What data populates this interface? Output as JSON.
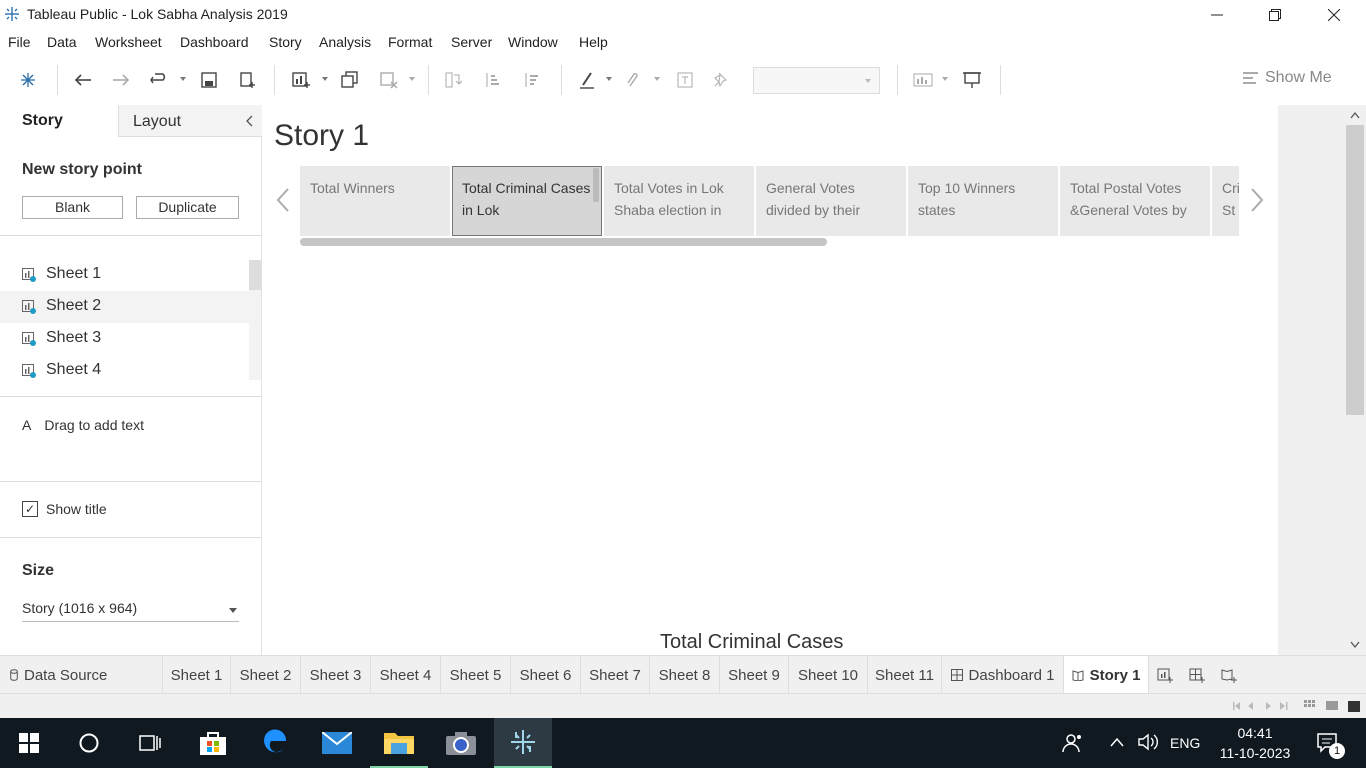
{
  "window": {
    "title": "Tableau Public - Lok Sabha Analysis 2019"
  },
  "menu": [
    "File",
    "Data",
    "Worksheet",
    "Dashboard",
    "Story",
    "Analysis",
    "Format",
    "Server",
    "Window",
    "Help"
  ],
  "toolbar": {
    "show_me": "Show Me"
  },
  "left_pane": {
    "tab_story": "Story",
    "tab_layout": "Layout",
    "new_story_point": "New story point",
    "blank_button": "Blank",
    "duplicate_button": "Duplicate",
    "sheets": [
      "Sheet 1",
      "Sheet 2",
      "Sheet 3",
      "Sheet 4"
    ],
    "drag_text_icon": "A",
    "drag_text": "Drag to add text",
    "show_title_check": "✓",
    "show_title": "Show title",
    "size_heading": "Size",
    "size_value": "Story (1016 x 964)"
  },
  "story": {
    "title": "Story 1",
    "points": [
      "Total Winners",
      "Total Criminal Cases in Lok",
      "Total  Votes in Lok Shaba election in",
      "General Votes divided by their",
      "Top 10 Winners states",
      "Total Postal Votes &General Votes by",
      "Cri St"
    ],
    "active_index": 1,
    "sheet_title": "Total Criminal Cases"
  },
  "bottom_tabs": [
    "Data Source",
    "Sheet 1",
    "Sheet 2",
    "Sheet 3",
    "Sheet 4",
    "Sheet 5",
    "Sheet 6",
    "Sheet 7",
    "Sheet 8",
    "Sheet 9",
    "Sheet 10",
    "Sheet 11",
    "Dashboard 1",
    "Story 1"
  ],
  "taskbar": {
    "lang": "ENG",
    "time": "04:41",
    "date": "11-10-2023",
    "notifications": "1"
  },
  "colors": {
    "accent": "#1f6ea8",
    "taskbar": "#101820"
  }
}
